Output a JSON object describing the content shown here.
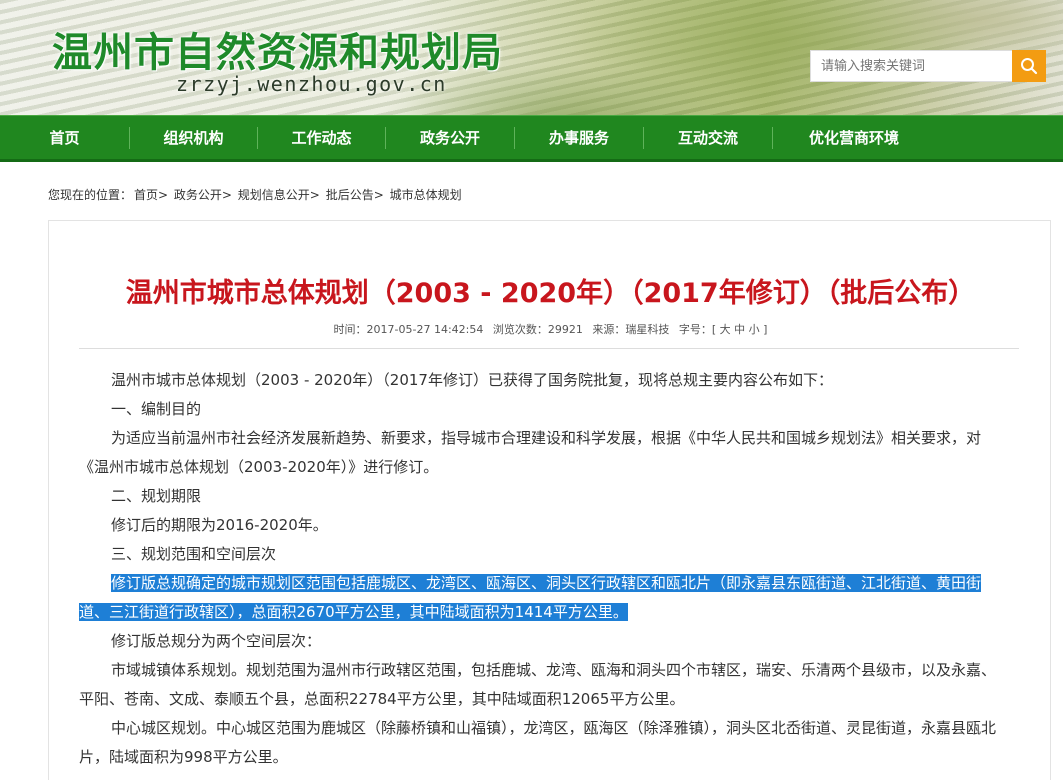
{
  "header": {
    "site_title": "温州市自然资源和规划局",
    "domain": "zrzyj.wenzhou.gov.cn",
    "search_placeholder": "请输入搜索关键词"
  },
  "nav": [
    "首页",
    "组织机构",
    "工作动态",
    "政务公开",
    "办事服务",
    "互动交流",
    "优化营商环境"
  ],
  "breadcrumb": {
    "prefix": "您现在的位置：",
    "items": [
      "首页>",
      "政务公开>",
      "规划信息公开>",
      "批后公告>",
      "城市总体规划"
    ]
  },
  "article": {
    "title": "温州市城市总体规划（2003 - 2020年）（2017年修订）（批后公布）",
    "time_label": "时间：2017-05-27 14:42:54",
    "views_label": "浏览次数：29921",
    "source_label": "来源：瑞星科技",
    "font_label": "字号：[ 大 中 小 ]",
    "paragraphs": [
      "温州市城市总体规划（2003 - 2020年）（2017年修订）已获得了国务院批复，现将总规主要内容公布如下：",
      "一、编制目的",
      "为适应当前温州市社会经济发展新趋势、新要求，指导城市合理建设和科学发展，根据《中华人民共和国城乡规划法》相关要求，对《温州市城市总体规划（2003-2020年）》进行修订。",
      "二、规划期限",
      "修订后的期限为2016-2020年。",
      "三、规划范围和空间层次",
      "修订版总规确定的城市规划区范围包括鹿城区、龙湾区、瓯海区、洞头区行政辖区和瓯北片（即永嘉县东瓯街道、江北街道、黄田街道、三江街道行政辖区），总面积2670平方公里，其中陆域面积为1414平方公里。",
      "修订版总规分为两个空间层次：",
      "市域城镇体系规划。规划范围为温州市行政辖区范围，包括鹿城、龙湾、瓯海和洞头四个市辖区，瑞安、乐清两个县级市，以及永嘉、平阳、苍南、文成、泰顺五个县，总面积22784平方公里，其中陆域面积12065平方公里。",
      "中心城区规划。中心城区范围为鹿城区（除藤桥镇和山福镇），龙湾区，瓯海区（除泽雅镇），洞头区北岙街道、灵昆街道，永嘉县瓯北片，陆域面积为998平方公里。"
    ]
  },
  "colors": {
    "nav_green": "#20871f",
    "title_red": "#c8161d",
    "search_orange": "#f39c12",
    "highlight_blue": "#1e7fd6"
  }
}
